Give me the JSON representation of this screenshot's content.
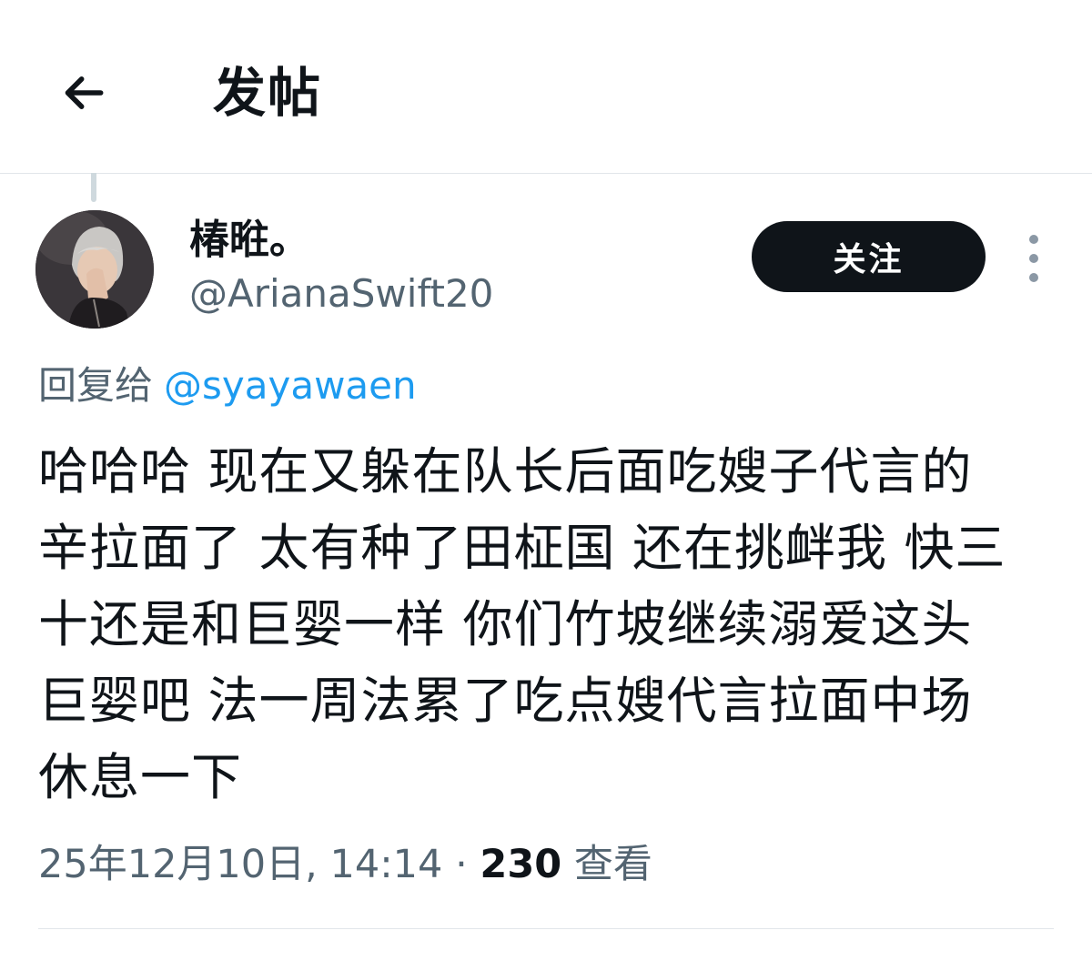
{
  "header": {
    "back_icon": "arrow-left-icon",
    "title": "发帖"
  },
  "author": {
    "display_name": "椿暀。",
    "handle": "@ArianaSwift20",
    "avatar": "profile-photo"
  },
  "actions": {
    "follow_label": "关注",
    "more_icon": "more-vertical-icon"
  },
  "reply": {
    "prefix": "回复给",
    "mention": "@syayawaen"
  },
  "tweet": {
    "text": "哈哈哈 现在又躲在队长后面吃嫂子代言的\n辛拉面了 太有种了田柾国 还在挑衅我 快三\n十还是和巨婴一样 你们竹坡继续溺爱这头\n巨婴吧 法一周法累了吃点嫂代言拉面中场\n休息一下"
  },
  "meta": {
    "timestamp": "25年12月10日, 14:14",
    "separator": "·",
    "views_count": "230",
    "views_label": "查看"
  },
  "colors": {
    "accent": "#1d9bf0",
    "secondary_text": "#536471",
    "follow_button_bg": "#0f1419"
  }
}
